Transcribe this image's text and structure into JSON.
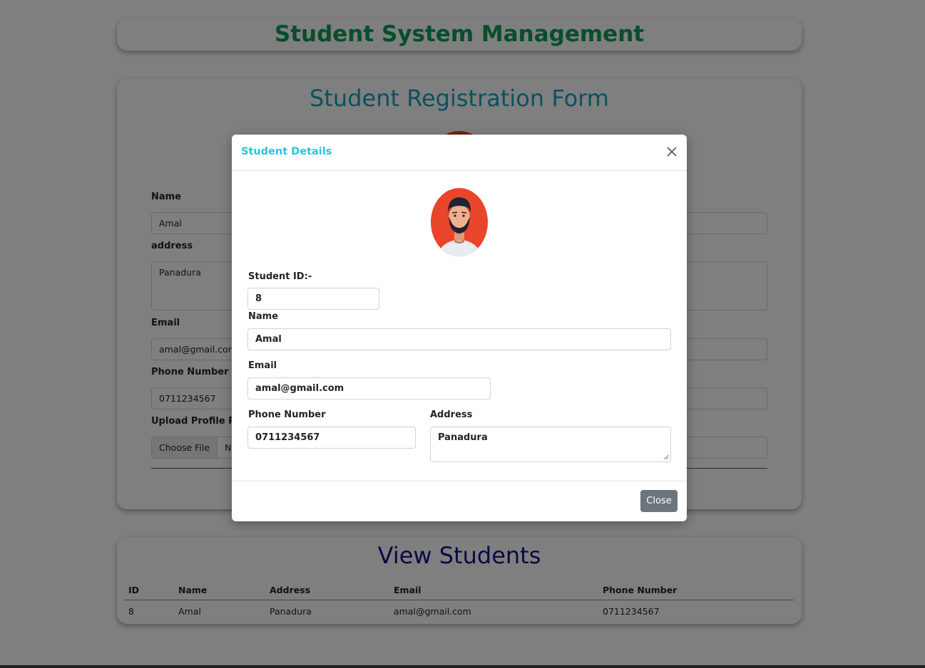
{
  "app": {
    "title": "Student System Management"
  },
  "registration_form": {
    "title": "Student Registration Form",
    "name_label": "Name",
    "name_value": "Amal",
    "address_label": "address",
    "address_value": "Panadura",
    "email_label": "Email",
    "email_value": "amal@gmail.com",
    "phone_label": "Phone Number",
    "phone_value": "0711234567",
    "upload_label": "Upload Profile Pic",
    "choose_file_label": "Choose File",
    "file_status": "No"
  },
  "view_students": {
    "title": "View Students",
    "columns": [
      "ID",
      "Name",
      "Address",
      "Email",
      "Phone Number"
    ],
    "rows": [
      {
        "id": "8",
        "name": "Amal",
        "address": "Panadura",
        "email": "amal@gmail.com",
        "phone": "0711234567"
      }
    ]
  },
  "modal": {
    "title": "Student Details",
    "student_id_label": "Student ID:-",
    "student_id_value": "8",
    "name_label": "Name",
    "name_value": "Amal",
    "email_label": "Email",
    "email_value": "amal@gmail.com",
    "phone_label": "Phone Number",
    "phone_value": "0711234567",
    "address_label": "Address",
    "address_value": "Panadura",
    "close_button_label": "Close",
    "close_icon": "close-icon",
    "avatar_icon": "avatar-icon"
  },
  "colors": {
    "app_title": "#0f9d58",
    "form_title": "#17a2b8",
    "view_title": "#12128a",
    "modal_title": "#1fc8e3",
    "avatar_bg": "#e8452a",
    "close_button": "#6c757d"
  }
}
